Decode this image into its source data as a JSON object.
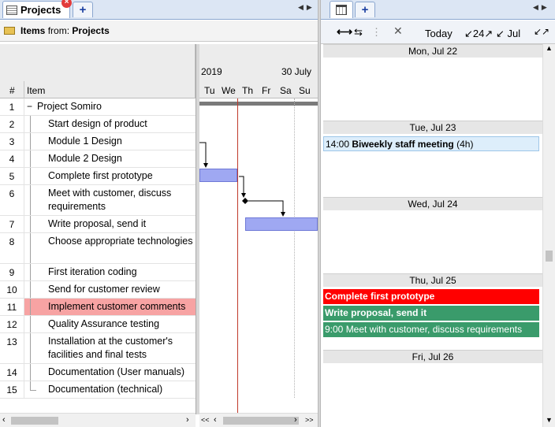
{
  "left_tabs": {
    "active": "Projects",
    "add": "+"
  },
  "right_tabs": {
    "add": "+"
  },
  "items_bar": {
    "prefix": "Items",
    "from": "from:",
    "source": "Projects"
  },
  "grid": {
    "col_num": "#",
    "col_item": "Item",
    "rows": [
      {
        "n": "1",
        "text": "Project Somiro",
        "level": 0
      },
      {
        "n": "2",
        "text": "Start design of product",
        "level": 1
      },
      {
        "n": "3",
        "text": "Module 1 Design",
        "level": 1
      },
      {
        "n": "4",
        "text": "Module 2 Design",
        "level": 1
      },
      {
        "n": "5",
        "text": "Complete first prototype",
        "level": 1
      },
      {
        "n": "6",
        "text": "Meet with customer, discuss requirements",
        "level": 1
      },
      {
        "n": "7",
        "text": "Write proposal, send it",
        "level": 1
      },
      {
        "n": "8",
        "text": "Choose appropriate technologies",
        "level": 1
      },
      {
        "n": "9",
        "text": "First iteration coding",
        "level": 1
      },
      {
        "n": "10",
        "text": "Send for customer review",
        "level": 1
      },
      {
        "n": "11",
        "text": "Implement customer comments",
        "level": 1
      },
      {
        "n": "12",
        "text": "Quality Assurance testing",
        "level": 1
      },
      {
        "n": "13",
        "text": "Installation at the customer's facilities and final tests",
        "level": 1
      },
      {
        "n": "14",
        "text": "Documentation (User manuals)",
        "level": 1
      },
      {
        "n": "15",
        "text": "Documentation (technical)",
        "level": 1
      }
    ],
    "collapse_glyph": "−"
  },
  "gantt": {
    "month_left": "2019",
    "month_right": "30 July",
    "days": [
      "Tu",
      "We",
      "Th",
      "Fr",
      "Sa",
      "Su"
    ],
    "scroll_left": "<<",
    "scroll_right": ">>"
  },
  "calendar_toolbar": {
    "today": "Today",
    "range": "24",
    "month": "Jul"
  },
  "calendar": {
    "days": [
      {
        "label": "Mon, Jul 22"
      },
      {
        "label": "Tue, Jul 23"
      },
      {
        "label": "Wed, Jul 24"
      },
      {
        "label": "Thu, Jul 25"
      },
      {
        "label": "Fri, Jul 26"
      }
    ],
    "events": {
      "meeting_time": "14:00",
      "meeting_title": "Biweekly staff meeting",
      "meeting_dur": "(4h)",
      "prototype": "Complete first prototype",
      "proposal": "Write proposal, send it",
      "meet_customer": "9:00 Meet with customer, discuss requirements"
    }
  },
  "colors": {
    "highlight_row": "#f7a3a3",
    "today_line": "#c0392b",
    "bar": "#9fa8f2",
    "event_red": "#ff0000",
    "event_green": "#3a9b6b",
    "meeting_bg": "#ddeefb"
  }
}
